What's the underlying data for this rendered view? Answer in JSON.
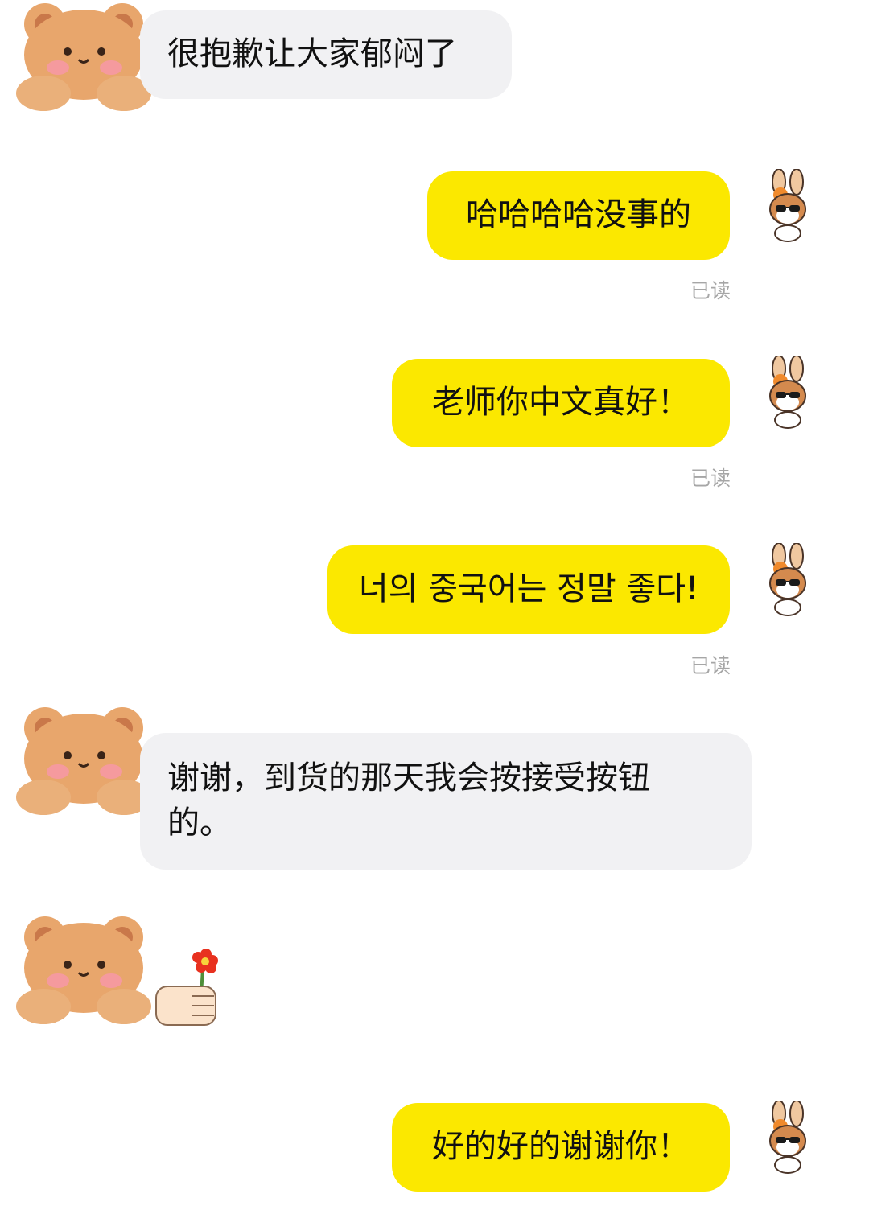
{
  "messages": [
    {
      "side": "in",
      "text": "很抱歉让大家郁闷了"
    },
    {
      "side": "out",
      "text": "哈哈哈哈没事的",
      "status": "已读"
    },
    {
      "side": "out",
      "text": "老师你中文真好！",
      "status": "已读"
    },
    {
      "side": "out",
      "text": "너의 중국어는 정말 좋다!",
      "status": "已读"
    },
    {
      "side": "in",
      "text": "谢谢，到货的那天我会按接受按钮\n的。"
    },
    {
      "side": "in",
      "sticker": "hand-holding-flower-icon"
    },
    {
      "side": "out",
      "text": "好的好的谢谢你！"
    }
  ],
  "avatars": {
    "incoming": "bear-avatar-icon",
    "outgoing": "bunny-sunglasses-avatar-icon"
  },
  "colors": {
    "incoming_bubble": "#f1f1f3",
    "outgoing_bubble": "#fbe800",
    "read_status": "#a6a6a6",
    "bear_fur": "#e8a66c"
  }
}
